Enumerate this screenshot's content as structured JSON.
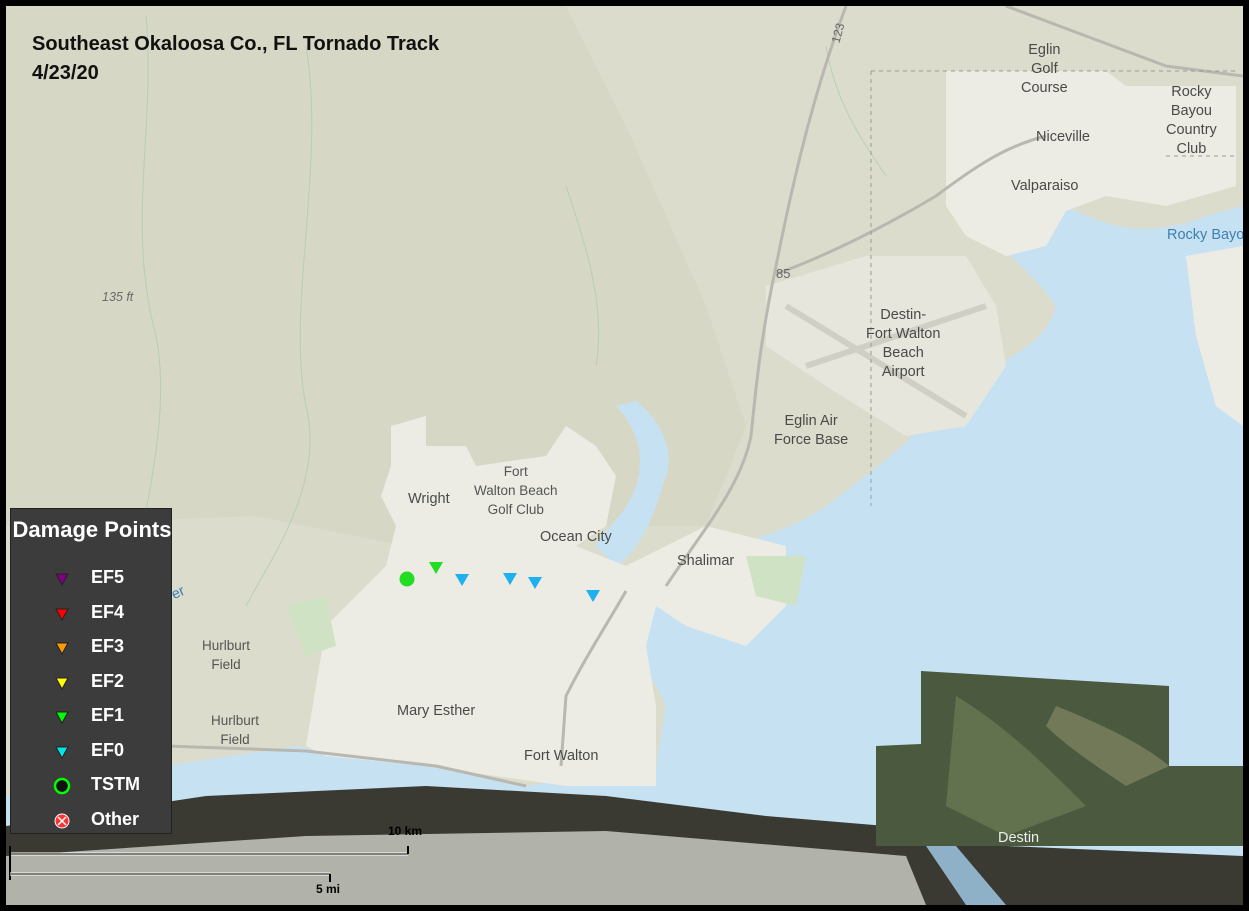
{
  "map": {
    "title_line1": "Southeast Okaloosa Co., FL Tornado Track",
    "title_line2": "4/23/20",
    "water_color": "#c6e2f2",
    "land_color": "#dcdccd",
    "urban_color": "#ecece4",
    "places": {
      "eglin_golf_1": "Eglin",
      "eglin_golf_2": "Golf",
      "eglin_golf_3": "Course",
      "rocky_bayou_cc_1": "Rocky",
      "rocky_bayou_cc_2": "Bayou",
      "rocky_bayou_cc_3": "Country",
      "rocky_bayou_cc_4": "Club",
      "niceville": "Niceville",
      "valparaiso": "Valparaiso",
      "rocky_bayou_water": "Rocky Bayo",
      "airport_1": "Destin-",
      "airport_2": "Fort Walton",
      "airport_3": "Beach",
      "airport_4": "Airport",
      "eglin_afb_1": "Eglin Air",
      "eglin_afb_2": "Force Base",
      "elev": "135 ft",
      "wright": "Wright",
      "fwb_golf_1": "Fort",
      "fwb_golf_2": "Walton Beach",
      "fwb_golf_3": "Golf Club",
      "ocean_city": "Ocean City",
      "shalimar": "Shalimar",
      "hurlburt_1a": "Hurlburt",
      "hurlburt_1b": "Field",
      "hurlburt_2a": "Hurlburt",
      "hurlburt_2b": "Field",
      "mary_esther": "Mary Esther",
      "fort_walton": "Fort Walton",
      "destin": "Destin",
      "highway_123": "123",
      "highway_85": "85",
      "river_fragment": "er"
    }
  },
  "legend": {
    "title": "Damage Points",
    "items": [
      {
        "label": "EF5",
        "color": "#800080",
        "shape": "triangle"
      },
      {
        "label": "EF4",
        "color": "#ff0000",
        "shape": "triangle"
      },
      {
        "label": "EF3",
        "color": "#ff9900",
        "shape": "triangle"
      },
      {
        "label": "EF2",
        "color": "#ffff00",
        "shape": "triangle"
      },
      {
        "label": "EF1",
        "color": "#00ff00",
        "shape": "triangle"
      },
      {
        "label": "EF0",
        "color": "#00e5e5",
        "shape": "triangle"
      },
      {
        "label": "TSTM",
        "color": "#00ff00",
        "shape": "circle"
      },
      {
        "label": "Other",
        "color": "#ff3333",
        "shape": "circle-x"
      }
    ]
  },
  "damage_points": [
    {
      "rating": "TSTM",
      "color": "#22dd22"
    },
    {
      "rating": "EF1",
      "color": "#22dd22"
    },
    {
      "rating": "EF0",
      "color": "#1fb0f0"
    },
    {
      "rating": "EF0",
      "color": "#1fb0f0"
    },
    {
      "rating": "EF0",
      "color": "#1fb0f0"
    },
    {
      "rating": "EF0",
      "color": "#1fb0f0"
    }
  ],
  "scale_bar": {
    "km_label": "10 km",
    "mi_label": "5 mi"
  }
}
